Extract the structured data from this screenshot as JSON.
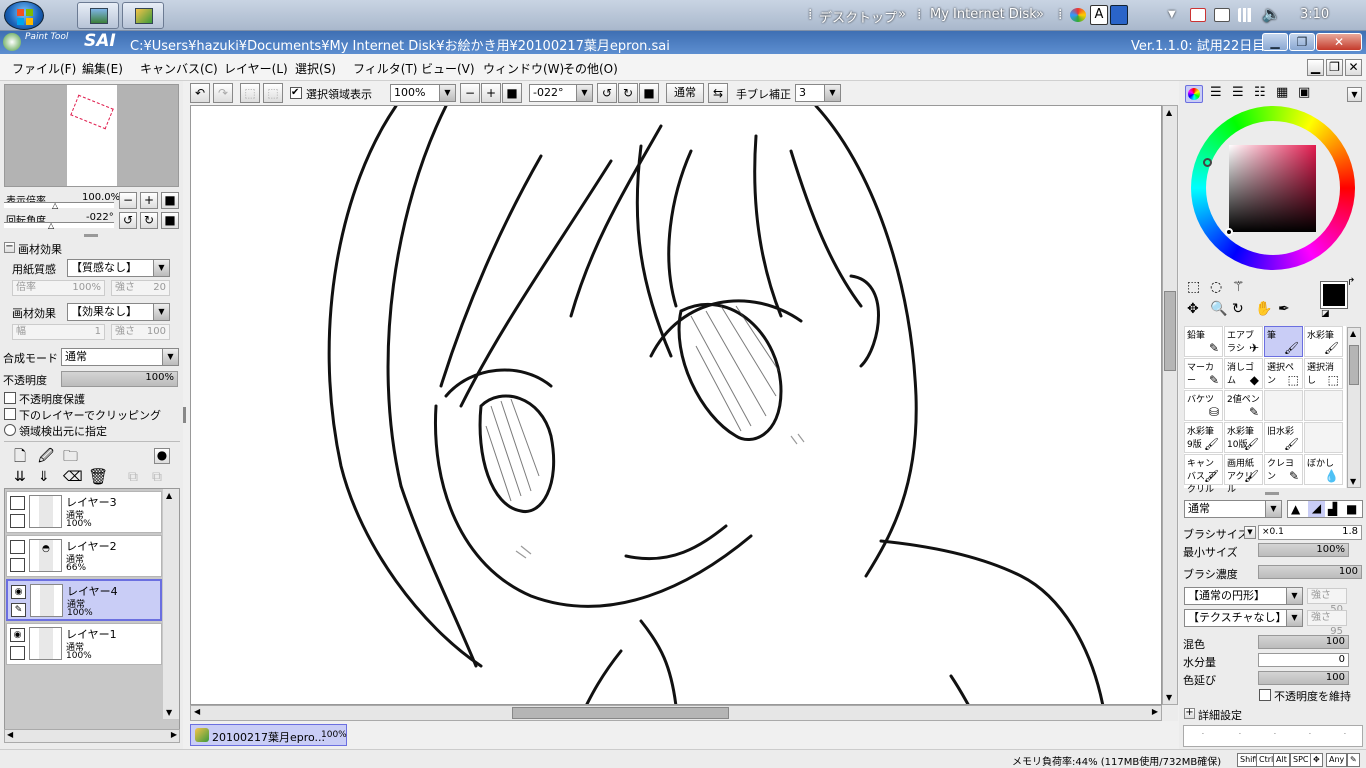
{
  "taskbar": {
    "desktop": "デスクトップ",
    "desktop_chevron": "»",
    "internet_disk": "My Internet Disk",
    "disk_chevron": "»",
    "clock": "3:10",
    "ime_letter": "A"
  },
  "titlebar": {
    "app_logo": "SAI",
    "app_logo_sub": "Paint Tool",
    "path": "C:¥Users¥hazuki¥Documents¥My Internet Disk¥お絵かき用¥20100217葉月epron.sai",
    "version": "Ver.1.1.0: 試用22日目"
  },
  "menu": [
    "ファイル(F)",
    "編集(E)",
    "キャンバス(C)",
    "レイヤー(L)",
    "選択(S)",
    "フィルタ(T)",
    "ビュー(V)",
    "ウィンドウ(W)",
    "その他(O)"
  ],
  "canvas_toolbar": {
    "show_selection_label": "選択領域表示",
    "zoom": "100%",
    "angle": "-022°",
    "blend": "通常",
    "stabilizer_label": "手ブレ補正",
    "stabilizer": "3"
  },
  "navigator": {
    "zoom_label": "表示倍率",
    "zoom_value": "100.0%",
    "rotate_label": "回転角度",
    "rotate_value": "-022°"
  },
  "texture": {
    "header": "画材効果",
    "paper_label": "用紙質感",
    "paper_value": "【質感なし】",
    "scale_label": "倍率",
    "scale_value": "100%",
    "strength_label": "強さ",
    "strength_value": "20",
    "effect_label": "画材効果",
    "effect_value": "【効果なし】",
    "width_label": "幅",
    "width_value": "1",
    "effect_strength_label": "強さ",
    "effect_strength_value": "100"
  },
  "layer_props": {
    "mode_label": "合成モード",
    "mode_value": "通常",
    "opacity_label": "不透明度",
    "opacity_value": "100%",
    "preserve_opacity": "不透明度保護",
    "clipping": "下のレイヤーでクリッピング",
    "selection_source": "領域検出元に指定"
  },
  "layers": [
    {
      "name": "レイヤー3",
      "mode": "通常",
      "opacity": "100%",
      "visible": false,
      "selected": false
    },
    {
      "name": "レイヤー2",
      "mode": "通常",
      "opacity": "66%",
      "visible": false,
      "selected": false
    },
    {
      "name": "レイヤー4",
      "mode": "通常",
      "opacity": "100%",
      "visible": true,
      "selected": true
    },
    {
      "name": "レイヤー1",
      "mode": "通常",
      "opacity": "100%",
      "visible": true,
      "selected": false
    }
  ],
  "tools": [
    [
      "鉛筆",
      "エアブラシ",
      "筆",
      "水彩筆"
    ],
    [
      "マーカー",
      "消しゴム",
      "選択ペン",
      "選択消し"
    ],
    [
      "バケツ",
      "2値ペン",
      "",
      ""
    ],
    [
      "水彩筆 9版",
      "水彩筆 10版",
      "旧水彩",
      ""
    ],
    [
      "キャンバス アクリル",
      "画用紙 アクリル",
      "クレヨン",
      "ぼかし"
    ]
  ],
  "brush": {
    "mode": "通常",
    "size_label": "ブラシサイズ",
    "size_mult": "×0.1",
    "size_value": "1.8",
    "min_size_label": "最小サイズ",
    "min_size_value": "100%",
    "density_label": "ブラシ濃度",
    "density_value": "100",
    "shape": "【通常の円形】",
    "shape_strength_label": "強さ",
    "shape_strength": "50",
    "texture": "【テクスチャなし】",
    "texture_strength_label": "強さ",
    "texture_strength": "95",
    "blend_label": "混色",
    "blend_value": "100",
    "water_label": "水分量",
    "water_value": "0",
    "stretch_label": "色延び",
    "stretch_value": "100",
    "keep_opacity_label": "不透明度を維持",
    "advanced_label": "詳細設定"
  },
  "color": {
    "current": "#000000"
  },
  "document_tab": {
    "name": "20100217葉月epro...",
    "zoom": "100%"
  },
  "status": {
    "memory": "メモリ負荷率:44% (117MB使用/732MB確保)",
    "keys": [
      "Shift",
      "Ctrl",
      "Alt",
      "SPC",
      "Any"
    ]
  }
}
